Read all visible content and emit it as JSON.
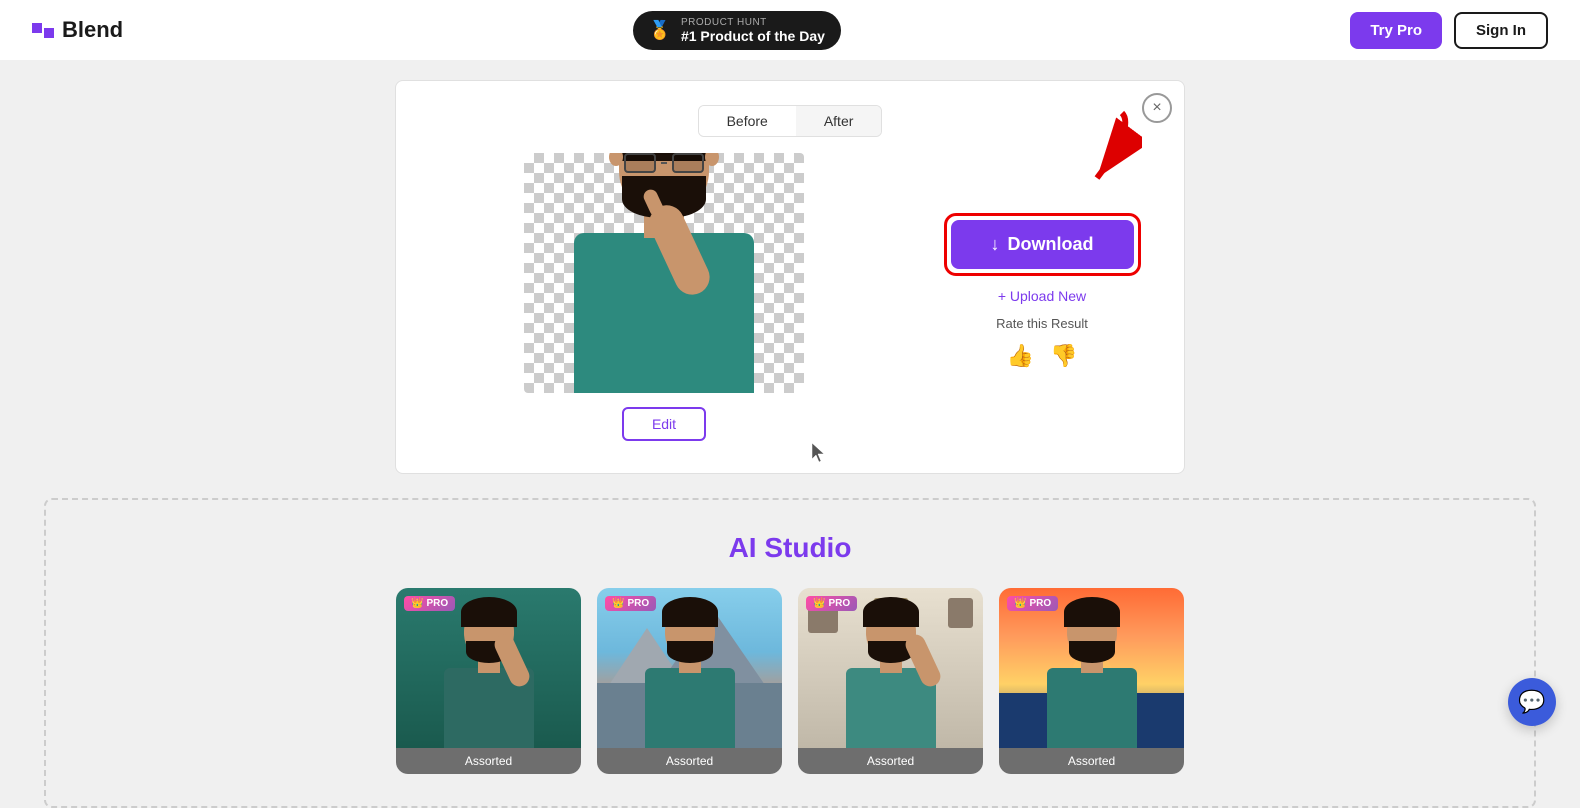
{
  "header": {
    "logo_text": "Blend",
    "product_hunt": {
      "label": "PRODUCT HUNT",
      "title": "#1 Product of the Day"
    },
    "try_pro_label": "Try Pro",
    "sign_in_label": "Sign In"
  },
  "modal": {
    "before_label": "Before",
    "after_label": "After",
    "edit_label": "Edit",
    "close_label": "×",
    "download_label": "↓ Download",
    "upload_new_label": "+ Upload New",
    "rate_label": "Rate this Result",
    "thumbs_up": "👍",
    "thumbs_down": "👎"
  },
  "ai_studio": {
    "title": "AI Studio",
    "items": [
      {
        "label": "Assorted",
        "bg": "teal"
      },
      {
        "label": "Assorted",
        "bg": "mountain"
      },
      {
        "label": "Assorted",
        "bg": "room"
      },
      {
        "label": "Assorted",
        "bg": "sunset"
      }
    ],
    "pro_badge": "PRO"
  },
  "icons": {
    "close": "×",
    "thumbs_up": "🖒",
    "thumbs_down": "🖓",
    "chat": "💬",
    "crown": "👑"
  }
}
